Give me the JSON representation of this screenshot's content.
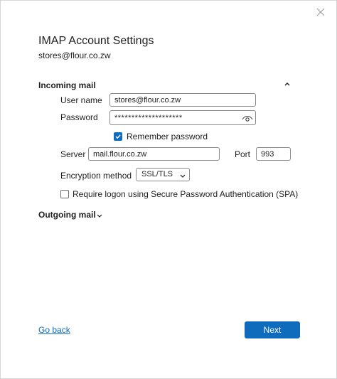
{
  "dialog": {
    "title": "IMAP Account Settings",
    "account_email": "stores@flour.co.zw",
    "close_icon": "close-icon"
  },
  "incoming": {
    "header": "Incoming mail",
    "collapse_icon": "chevron-up-icon",
    "username_label": "User name",
    "username_value": "stores@flour.co.zw",
    "password_label": "Password",
    "password_value": "********************",
    "show_password_icon": "eye-icon",
    "remember_label": "Remember password",
    "remember_checked": true,
    "server_label": "Server",
    "server_value": "mail.flour.co.zw",
    "port_label": "Port",
    "port_value": "993",
    "encryption_label": "Encryption method",
    "encryption_value": "SSL/TLS",
    "spa_label": "Require logon using Secure Password Authentication (SPA)",
    "spa_checked": false
  },
  "outgoing": {
    "header": "Outgoing mail",
    "expand_icon": "chevron-down-icon"
  },
  "footer": {
    "back_label": "Go back",
    "next_label": "Next"
  },
  "colors": {
    "accent": "#0f6cbd",
    "border": "#8a8a8a"
  }
}
